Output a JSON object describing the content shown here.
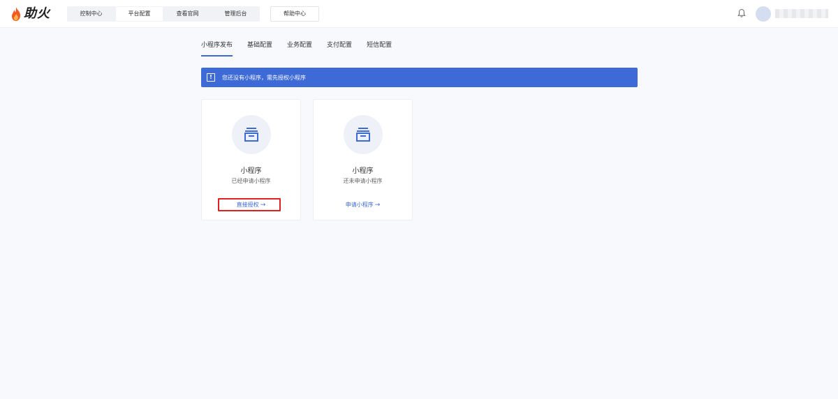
{
  "header": {
    "logo_text": "助火",
    "nav": [
      {
        "label": "控制中心"
      },
      {
        "label": "平台配置"
      },
      {
        "label": "查看官网"
      },
      {
        "label": "管理后台"
      }
    ],
    "help_label": "帮助中心",
    "username": "██████"
  },
  "tabs": [
    {
      "label": "小程序发布"
    },
    {
      "label": "基础配置"
    },
    {
      "label": "业务配置"
    },
    {
      "label": "支付配置"
    },
    {
      "label": "短信配置"
    }
  ],
  "notice": {
    "icon": "!",
    "text": "您还没有小程序，需先授权小程序"
  },
  "cards": [
    {
      "title": "小程序",
      "desc": "已经申请小程序",
      "link": "直接授权",
      "arrow": "→"
    },
    {
      "title": "小程序",
      "desc": "还未申请小程序",
      "link": "申请小程序",
      "arrow": "→"
    }
  ],
  "colors": {
    "accent": "#3d6ad6",
    "highlight": "#e02020",
    "logo_flame": "#f15a24"
  }
}
